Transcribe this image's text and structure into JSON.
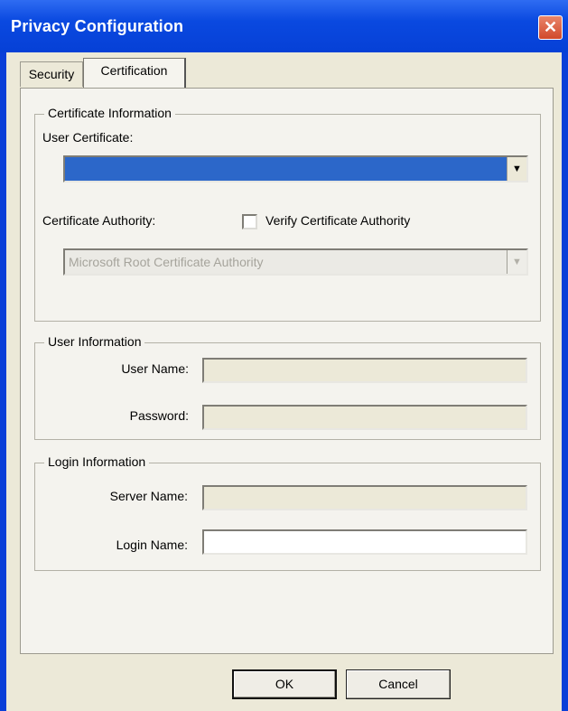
{
  "window": {
    "title": "Privacy Configuration",
    "close_glyph": "✕"
  },
  "tabs": [
    {
      "label": "Security",
      "active": false
    },
    {
      "label": "Certification",
      "active": true
    }
  ],
  "certificate_info": {
    "legend": "Certificate Information",
    "user_certificate_label": "User Certificate:",
    "user_certificate_value": "",
    "certificate_authority_label": "Certificate Authority:",
    "verify_label": "Verify Certificate Authority",
    "verify_checked": false,
    "authority_value": "Microsoft Root Certificate Authority",
    "dropdown_glyph": "▼"
  },
  "user_info": {
    "legend": "User Information",
    "user_name_label": "User Name:",
    "user_name_value": "",
    "password_label": "Password:",
    "password_value": ""
  },
  "login_info": {
    "legend": "Login Information",
    "server_name_label": "Server Name:",
    "server_name_value": "",
    "login_name_label": "Login Name:",
    "login_name_value": ""
  },
  "buttons": {
    "ok": "OK",
    "cancel": "Cancel"
  },
  "colors": {
    "titlebar": "#0a49e0",
    "selection": "#2c67c9",
    "face": "#ece9d8",
    "close": "#d1492a"
  }
}
